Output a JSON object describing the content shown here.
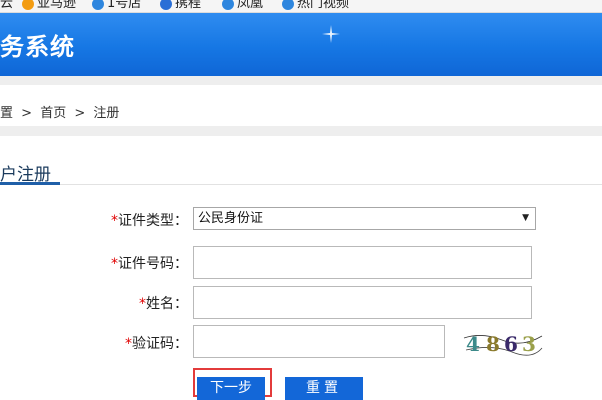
{
  "bookmarks": [
    {
      "label": "云",
      "color": "#1e88e5"
    },
    {
      "label": "亚马逊",
      "color": "#f39c12"
    },
    {
      "label": "1号店",
      "color": "#2e86de"
    },
    {
      "label": "携程",
      "color": "#2a6fd6"
    },
    {
      "label": "凤凰",
      "color": "#2e86de"
    },
    {
      "label": "热门视频",
      "color": "#2e86de"
    }
  ],
  "banner": {
    "title": "务系统"
  },
  "breadcrumb": {
    "current_location": "置",
    "sep1": ">",
    "home": "首页",
    "sep2": ">",
    "page": "注册"
  },
  "section": {
    "title": "户注册"
  },
  "form": {
    "required_mark": "*",
    "id_type_label": "证件类型：",
    "id_type_value": "公民身份证",
    "id_number_label": "证件号码：",
    "name_label": "姓名：",
    "captcha_label": "验证码：",
    "captcha_text": "4863"
  },
  "buttons": {
    "next": "下一步",
    "reset": "重置"
  },
  "colors": {
    "banner": "#1677e4",
    "button": "#1367d8",
    "required": "#e00000",
    "highlight": "#e33b3b"
  }
}
